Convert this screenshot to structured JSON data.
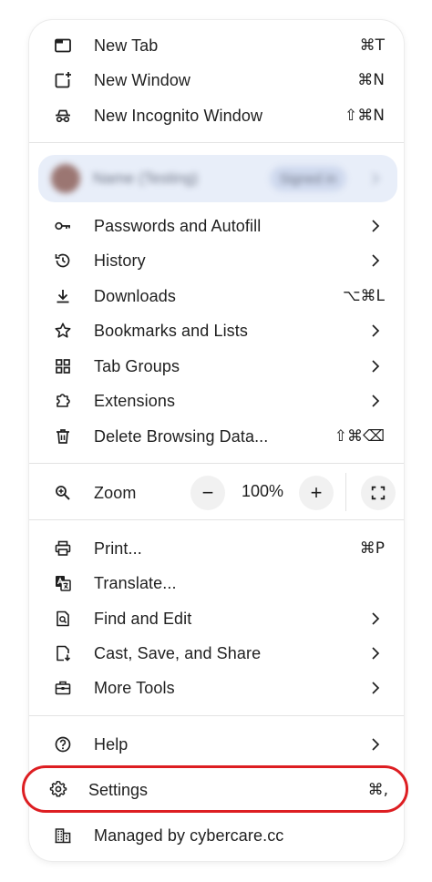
{
  "menu": {
    "new_tab": {
      "label": "New Tab",
      "shortcut": "⌘T",
      "icon": "tab-icon"
    },
    "new_window": {
      "label": "New Window",
      "shortcut": "⌘N",
      "icon": "new-window-icon"
    },
    "new_incognito": {
      "label": "New Incognito Window",
      "shortcut": "⇧⌘N",
      "icon": "incognito-icon"
    },
    "profile": {
      "name": "Name (Testing)",
      "badge": "Signed in"
    },
    "passwords": {
      "label": "Passwords and Autofill",
      "icon": "key-icon"
    },
    "history": {
      "label": "History",
      "icon": "history-icon"
    },
    "downloads": {
      "label": "Downloads",
      "shortcut": "⌥⌘L",
      "icon": "download-icon"
    },
    "bookmarks": {
      "label": "Bookmarks and Lists",
      "icon": "star-icon"
    },
    "tab_groups": {
      "label": "Tab Groups",
      "icon": "grid-icon"
    },
    "extensions": {
      "label": "Extensions",
      "icon": "puzzle-icon"
    },
    "delete_data": {
      "label": "Delete Browsing Data...",
      "shortcut": "⇧⌘⌫",
      "icon": "trash-icon"
    },
    "zoom": {
      "label": "Zoom",
      "minus": "−",
      "value": "100%",
      "plus": "+",
      "icon": "zoom-icon"
    },
    "print": {
      "label": "Print...",
      "shortcut": "⌘P",
      "icon": "printer-icon"
    },
    "translate": {
      "label": "Translate...",
      "icon": "translate-icon"
    },
    "find_edit": {
      "label": "Find and Edit",
      "icon": "find-icon"
    },
    "cast_save": {
      "label": "Cast, Save, and Share",
      "icon": "cast-save-icon"
    },
    "more_tools": {
      "label": "More Tools",
      "icon": "toolbox-icon"
    },
    "help": {
      "label": "Help",
      "icon": "help-icon"
    },
    "settings": {
      "label": "Settings",
      "shortcut": "⌘,",
      "icon": "gear-icon"
    },
    "managed": {
      "label": "Managed by cybercare.cc",
      "icon": "building-icon"
    }
  },
  "colors": {
    "highlight": "#dd1e22",
    "profile_bg": "#e8eef9",
    "divider": "#e3e3e3"
  }
}
